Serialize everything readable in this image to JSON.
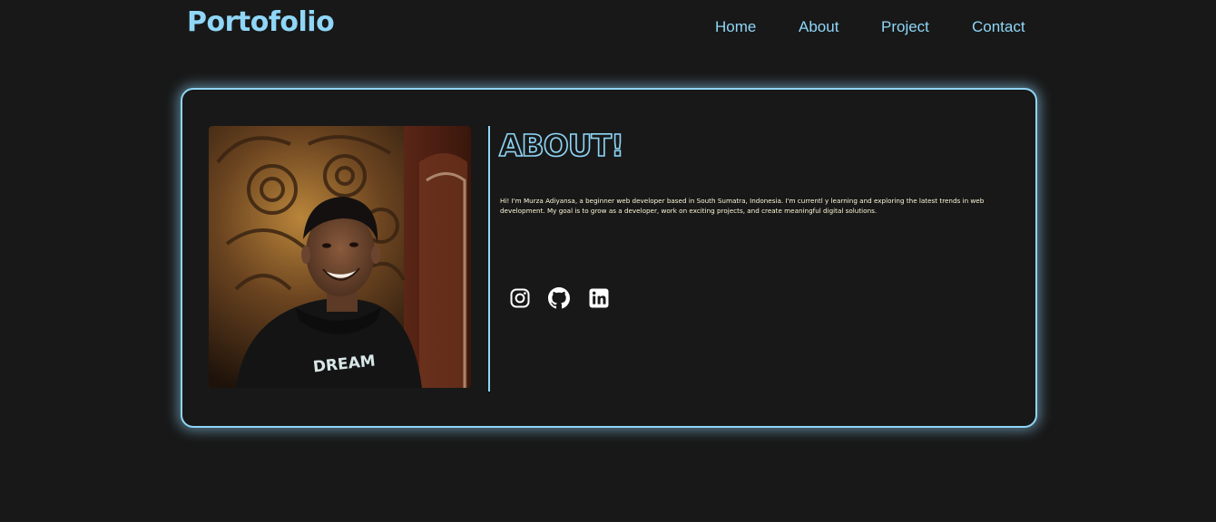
{
  "nav": {
    "logo": "Portofolio",
    "links": [
      "Home",
      "About",
      "Project",
      "Contact"
    ]
  },
  "about": {
    "title": "ABOUT!",
    "text": "Hi! I'm Murza Adiyansa, a beginner web developer based in South Sumatra, Indonesia. I'm currentl y learning and exploring the latest trends in web development. My goal is to grow as a developer, work on exciting projects, and create meaningful digital solutions.",
    "photo_shirt_text": "DREAM"
  },
  "socials": [
    {
      "icon": "instagram-icon"
    },
    {
      "icon": "github-icon"
    },
    {
      "icon": "linkedin-icon"
    }
  ],
  "colors": {
    "background": "#181818",
    "accent": "#8fd6f7",
    "body_text": "#fff8d8",
    "icon": "#ffffff"
  }
}
